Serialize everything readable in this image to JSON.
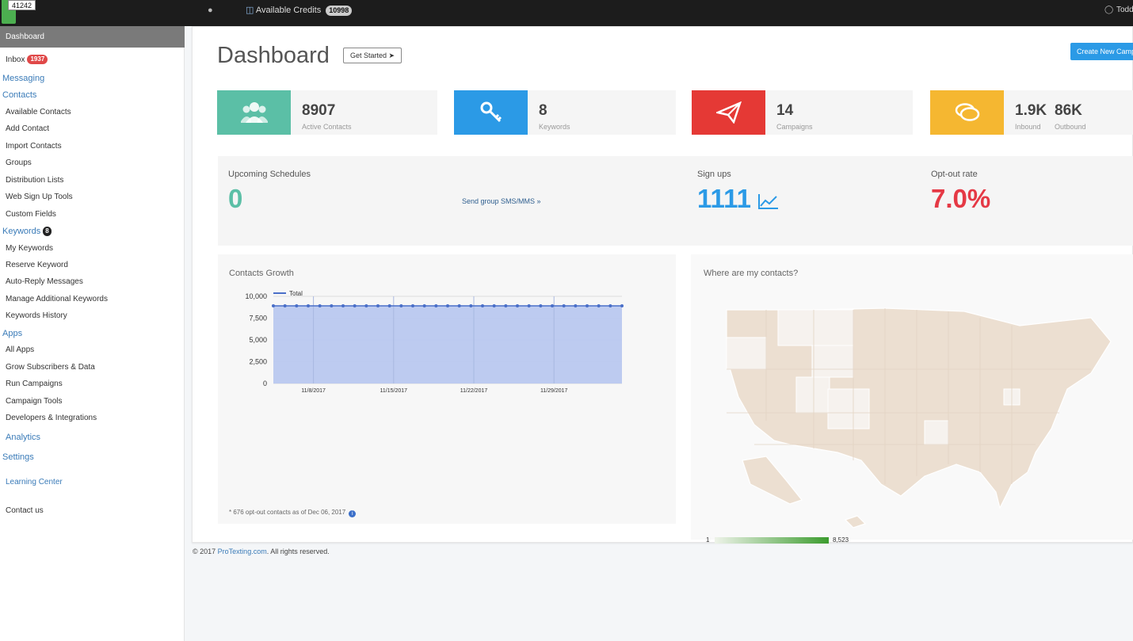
{
  "topbar": {
    "badge_id": "41242",
    "credits_label": "Available Credits",
    "credits_value": "10998",
    "user": "Todd"
  },
  "sidebar": {
    "items": [
      {
        "label": "Dashboard"
      },
      {
        "label": "Inbox",
        "badge": "1937"
      },
      {
        "label": "Messaging"
      },
      {
        "label": "Contacts"
      },
      {
        "label": "Available Contacts"
      },
      {
        "label": "Add Contact"
      },
      {
        "label": "Import Contacts"
      },
      {
        "label": "Groups"
      },
      {
        "label": "Distribution Lists"
      },
      {
        "label": "Web Sign Up Tools"
      },
      {
        "label": "Custom Fields"
      },
      {
        "label": "Keywords",
        "badge": "8"
      },
      {
        "label": "My Keywords"
      },
      {
        "label": "Reserve Keyword"
      },
      {
        "label": "Auto-Reply Messages"
      },
      {
        "label": "Manage Additional Keywords"
      },
      {
        "label": "Keywords History"
      },
      {
        "label": "Apps"
      },
      {
        "label": "All Apps"
      },
      {
        "label": "Grow Subscribers & Data"
      },
      {
        "label": "Run Campaigns"
      },
      {
        "label": "Campaign Tools"
      },
      {
        "label": "Developers & Integrations"
      },
      {
        "label": "Analytics"
      },
      {
        "label": "Settings"
      },
      {
        "label": "Learning Center"
      },
      {
        "label": "Contact us"
      }
    ]
  },
  "header": {
    "title": "Dashboard",
    "get_started": "Get Started",
    "create_button": "Create New Campaign"
  },
  "stats": [
    {
      "value": "8907",
      "label": "Active Contacts",
      "color": "#5bbfa6",
      "icon": "users-icon"
    },
    {
      "value": "8",
      "label": "Keywords",
      "color": "#2b9ae6",
      "icon": "key-icon"
    },
    {
      "value": "14",
      "label": "Campaigns",
      "color": "#e53935",
      "icon": "paper-plane-icon"
    },
    {
      "value": "1.9K",
      "label": "Inbound",
      "value2": "86K",
      "label2": "Outbound",
      "color": "#f5b731",
      "icon": "chat-bubbles-icon"
    }
  ],
  "info": {
    "schedules_title": "Upcoming Schedules",
    "schedules_value": "0",
    "send_link": "Send group SMS/MMS »",
    "signups_title": "Sign ups",
    "signups_value": "1111",
    "optout_title": "Opt-out rate",
    "optout_value": "7.0%"
  },
  "growth": {
    "title": "Contacts Growth",
    "footnote": "* 676 opt-out contacts as of Dec 06, 2017"
  },
  "map": {
    "title": "Where are my contacts?",
    "legend_min": "1",
    "legend_max": "8,523"
  },
  "footer": {
    "copyright": "© 2017",
    "site": "ProTexting.com",
    "rights": ". All rights reserved."
  },
  "chart_data": {
    "type": "area",
    "series": [
      {
        "name": "Total",
        "values": [
          8907,
          8907,
          8907,
          8907,
          8907,
          8907,
          8907,
          8907,
          8907,
          8907,
          8907,
          8907,
          8907,
          8907,
          8907,
          8907,
          8907,
          8907,
          8907,
          8907,
          8907,
          8907,
          8907,
          8907,
          8907,
          8907,
          8907,
          8907,
          8907,
          8907,
          8907
        ]
      }
    ],
    "x_tick_labels": [
      "11/8/2017",
      "11/15/2017",
      "11/22/2017",
      "11/29/2017"
    ],
    "y_ticks": [
      "0",
      "2,500",
      "5,000",
      "7,500",
      "10,000"
    ],
    "ylim": [
      0,
      10000
    ],
    "legend": "top-left",
    "grid": true,
    "colors": {
      "fill": "#b9c8ef",
      "line": "#4a6fc8"
    }
  }
}
